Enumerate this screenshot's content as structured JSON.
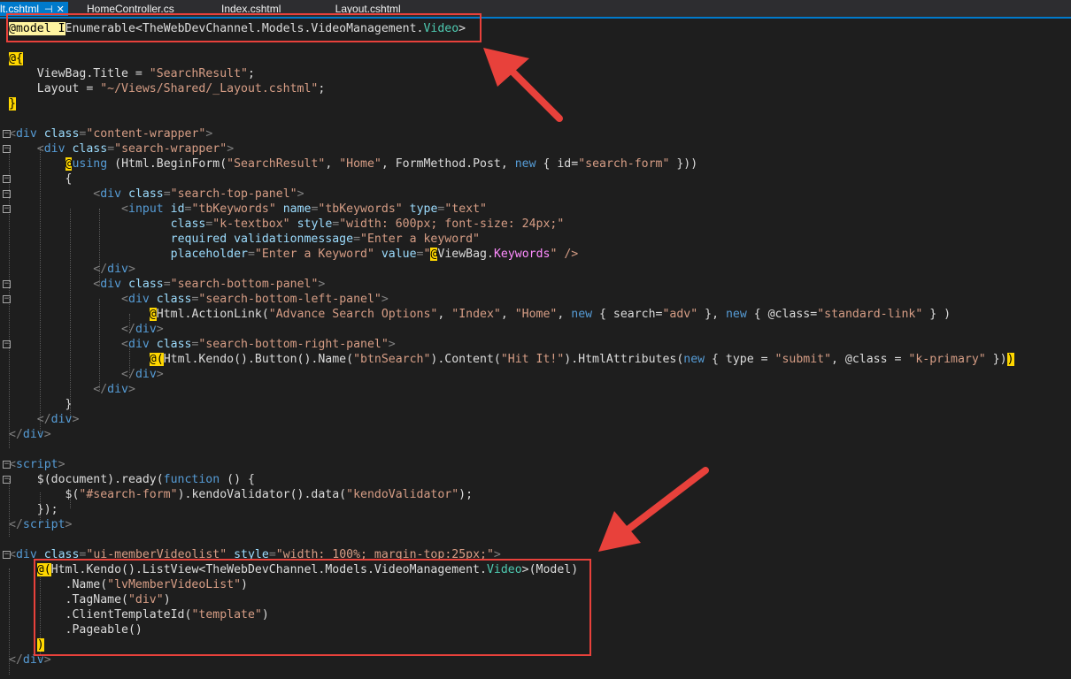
{
  "tabs": [
    {
      "label": "lt.cshtml",
      "pin": "⊣",
      "close": "✕",
      "active": true
    },
    {
      "label": "HomeController.cs",
      "active": false
    },
    {
      "label": "Index.cshtml",
      "active": false
    },
    {
      "label": "_Layout.cshtml",
      "active": false
    }
  ],
  "code": {
    "l1_razor": "@model",
    "l1_i": " I",
    "l1_rest": "Enumerable<",
    "l1_ns": "TheWebDevChannel.Models.VideoManagement.",
    "l1_type": "Video",
    "l1_end": ">",
    "l3": "@{",
    "l4_a": "    ViewBag.Title = ",
    "l4_s": "\"SearchResult\"",
    "l4_e": ";",
    "l5_a": "    Layout = ",
    "l5_s": "\"~/Views/Shared/_Layout.cshtml\"",
    "l5_e": ";",
    "l6": "}",
    "l8_a": "<",
    "l8_tag": "div",
    "l8_attr": " class",
    "l8_eq": "=",
    "l8_val": "\"content-wrapper\"",
    "l8_end": ">",
    "l9_ind": "    ",
    "l9_val": "\"search-wrapper\"",
    "l10_ind": "        ",
    "l10_r": "@",
    "l10_k": "using",
    "l10_a": " (Html.BeginForm(",
    "l10_s1": "\"SearchResult\"",
    "l10_c1": ", ",
    "l10_s2": "\"Home\"",
    "l10_c2": ", FormMethod.Post, ",
    "l10_new": "new",
    "l10_b": " { id=",
    "l10_s3": "\"search-form\"",
    "l10_e": " }))",
    "l11": "        {",
    "l12_ind": "            ",
    "l12_val": "\"search-top-panel\"",
    "l13_ind": "                ",
    "l13_tag": "input",
    "l13_id": " id",
    "l13_idv": "\"tbKeywords\"",
    "l13_name": " name",
    "l13_namev": "\"tbKeywords\"",
    "l13_type": " type",
    "l13_typev": "\"text\"",
    "l14_ind": "                       ",
    "l14_cls": "class",
    "l14_clsv": "\"k-textbox\"",
    "l14_sty": " style",
    "l14_styv": "\"width: 600px; font-size: 24px;\"",
    "l15_ind": "                       ",
    "l15_req": "required validationmessage",
    "l15_reqv": "\"Enter a keyword\"",
    "l16_ind": "                       ",
    "l16_ph": "placeholder",
    "l16_phv": "\"Enter a Keyword\"",
    "l16_val": " value",
    "l16_q": "\"",
    "l16_at": "@",
    "l16_vb": "ViewBag.",
    "l16_kw": "Keywords",
    "l16_end": "\" />",
    "l17_ind": "            ",
    "l18_val": "\"search-bottom-panel\"",
    "l19_ind": "                ",
    "l19_val": "\"search-bottom-left-panel\"",
    "l20_ind": "                    ",
    "l20_at": "@",
    "l20_h": "Html",
    "l20_a": ".ActionLink(",
    "l20_s1": "\"Advance Search Options\"",
    "l20_c1": ", ",
    "l20_s2": "\"Index\"",
    "l20_c2": ", ",
    "l20_s3": "\"Home\"",
    "l20_c3": ", ",
    "l20_new1": "new",
    "l20_b1": " { search=",
    "l20_s4": "\"adv\"",
    "l20_b2": " }, ",
    "l20_new2": "new",
    "l20_b3": " { @class=",
    "l20_s5": "\"standard-link\"",
    "l20_e": " } )",
    "l21_ind": "                ",
    "l22_val": "\"search-bottom-right-panel\"",
    "l23_ind": "                    ",
    "l23_at": "@(",
    "l23_h": "Html",
    "l23_a": ".Kendo().Button().Name(",
    "l23_s1": "\"btnSearch\"",
    "l23_b": ").Content(",
    "l23_s2": "\"Hit It!\"",
    "l23_c": ").HtmlAttributes(",
    "l23_new": "new",
    "l23_d": " { type = ",
    "l23_s3": "\"submit\"",
    "l23_e2": ", @class = ",
    "l23_s4": "\"k-primary\"",
    "l23_f": " })",
    "l23_close": ")",
    "l26": "        }",
    "l27_ind": "    ",
    "l30_tag": "script",
    "l31_a": "    $(document).ready(",
    "l31_k": "function",
    "l31_b": " () {",
    "l32_a": "        $(",
    "l32_s1": "\"#search-form\"",
    "l32_b": ").kendoValidator().data(",
    "l32_s2": "\"kendoValidator\"",
    "l32_e": ");",
    "l33": "    });",
    "l36_val": "\"ui-memberVideolist\"",
    "l36_sty": " style",
    "l36_styv": "\"width: 100%; margin-top:25px;\"",
    "l37_ind": "    ",
    "l37_at": "@(",
    "l37_h": "Html",
    "l37_a": ".Kendo().ListView<",
    "l37_ns": "TheWebDevChannel.Models.VideoManagement.",
    "l37_type": "Video",
    "l37_e": ">(Model)",
    "l38_a": "        .Name(",
    "l38_s": "\"lvMemberVideoList\"",
    "l38_e": ")",
    "l39_a": "        .TagName(",
    "l39_s": "\"div\"",
    "l39_e": ")",
    "l40_a": "        .ClientTemplateId(",
    "l40_s": "\"template\"",
    "l40_e": ")",
    "l41": "        .Pageable()",
    "l42_ind": "    ",
    "l42": ")"
  },
  "colors": {
    "accent": "#007acc",
    "annotation": "#e8413b",
    "background": "#1e1e1e"
  }
}
